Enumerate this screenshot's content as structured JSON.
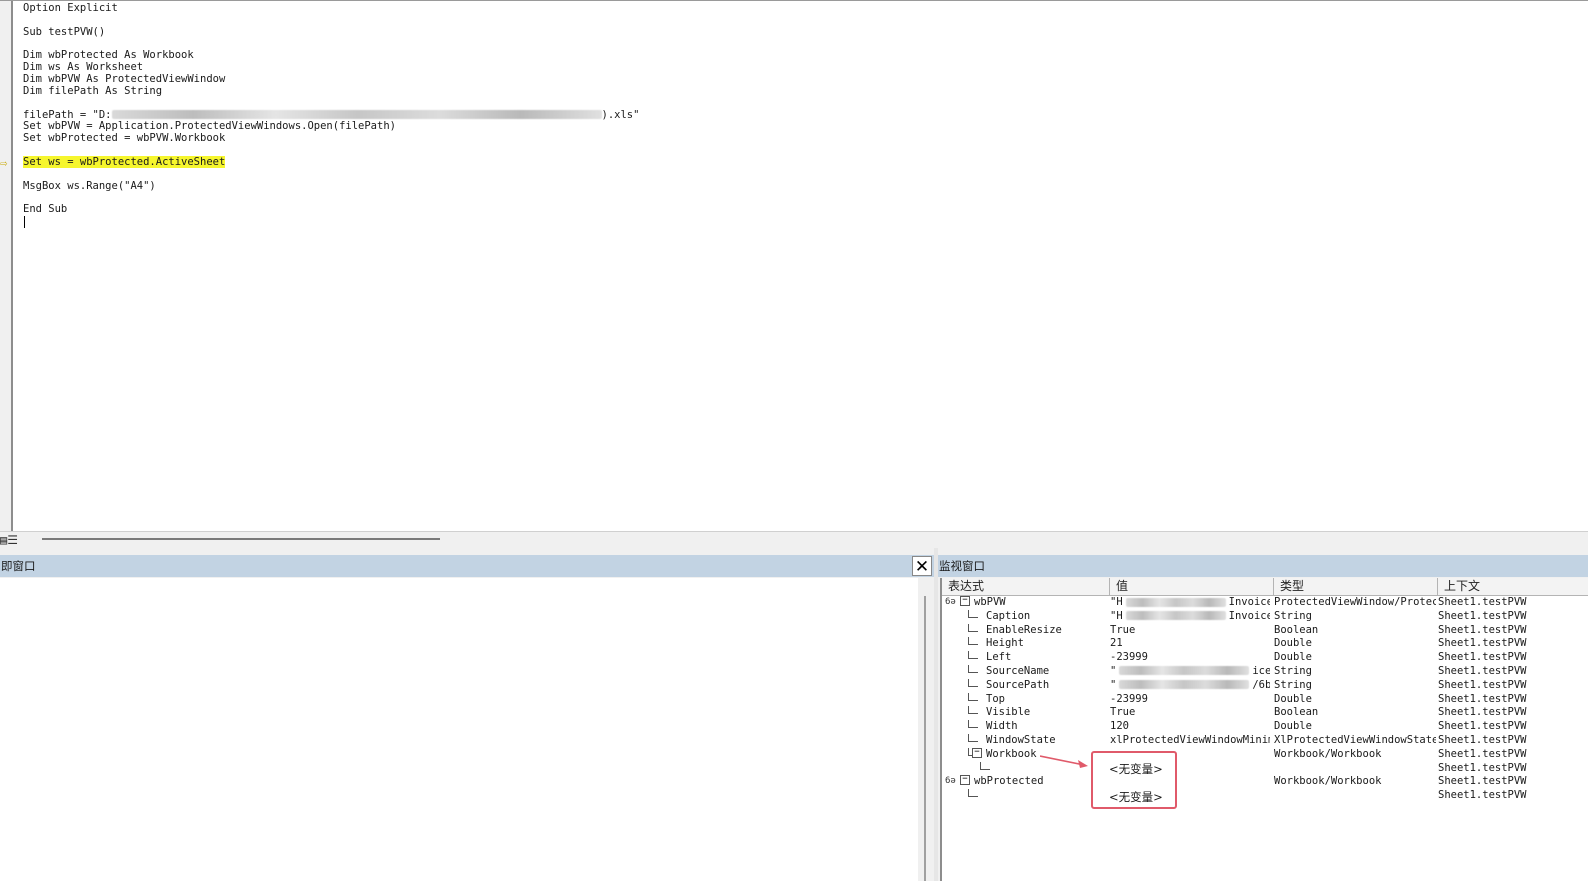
{
  "editor": {
    "lines": [
      {
        "text": "Option Explicit"
      },
      {
        "text": ""
      },
      {
        "text": "Sub testPVW()"
      },
      {
        "text": ""
      },
      {
        "text": "Dim wbProtected As Workbook"
      },
      {
        "text": "Dim ws As Worksheet"
      },
      {
        "text": "Dim wbPVW As ProtectedViewWindow"
      },
      {
        "text": "Dim filePath As String"
      },
      {
        "text": ""
      },
      {
        "text": "filePath = \"D:",
        "redacted_suffix": ").xls\""
      },
      {
        "text": "Set wbPVW = Application.ProtectedViewWindows.Open(filePath)"
      },
      {
        "text": "Set wbProtected = wbPVW.Workbook"
      },
      {
        "text": ""
      },
      {
        "text": "Set ws = wbProtected.ActiveSheet",
        "highlight": true
      },
      {
        "text": ""
      },
      {
        "text": "MsgBox ws.Range(\"A4\")"
      },
      {
        "text": ""
      },
      {
        "text": "End Sub"
      }
    ],
    "exec_arrow": "⇨",
    "view_icons": "▤☰"
  },
  "immediate": {
    "title": "即窗口",
    "close": "✕"
  },
  "watch": {
    "title": "监视窗口",
    "columns": [
      "表达式",
      "值",
      "类型",
      "上下文"
    ],
    "rows": [
      {
        "expr": "wbPVW",
        "value": "\"H",
        "value_tail": "Invoice",
        "type": "ProtectedViewWindow/Protect",
        "context": "Sheet1.testPVW",
        "level": 0,
        "expander": "−",
        "glasses": true
      },
      {
        "expr": "Caption",
        "value": "\"H",
        "value_tail": "Invoice",
        "type": "String",
        "context": "Sheet1.testPVW",
        "level": 1
      },
      {
        "expr": "EnableResize",
        "value": "True",
        "type": "Boolean",
        "context": "Sheet1.testPVW",
        "level": 1
      },
      {
        "expr": "Height",
        "value": "21",
        "type": "Double",
        "context": "Sheet1.testPVW",
        "level": 1
      },
      {
        "expr": "Left",
        "value": "-23999",
        "type": "Double",
        "context": "Sheet1.testPVW",
        "level": 1
      },
      {
        "expr": "SourceName",
        "value": "\"",
        "value_tail": "ice",
        "type": "String",
        "context": "Sheet1.testPVW",
        "level": 1
      },
      {
        "expr": "SourcePath",
        "value": "\"",
        "value_tail": "/6b",
        "type": "String",
        "context": "Sheet1.testPVW",
        "level": 1
      },
      {
        "expr": "Top",
        "value": "-23999",
        "type": "Double",
        "context": "Sheet1.testPVW",
        "level": 1
      },
      {
        "expr": "Visible",
        "value": "True",
        "type": "Boolean",
        "context": "Sheet1.testPVW",
        "level": 1
      },
      {
        "expr": "Width",
        "value": "120",
        "type": "Double",
        "context": "Sheet1.testPVW",
        "level": 1
      },
      {
        "expr": "WindowState",
        "value": "xlProtectedViewWindowMinimi",
        "type": "XlProtectedViewWindowState",
        "context": "Sheet1.testPVW",
        "level": 1
      },
      {
        "expr": "Workbook",
        "value": "",
        "type": "Workbook/Workbook",
        "context": "Sheet1.testPVW",
        "level": 1,
        "expander": "−"
      },
      {
        "expr": "",
        "value": "",
        "type": "",
        "context": "Sheet1.testPVW",
        "level": 2
      },
      {
        "expr": "wbProtected",
        "value": "",
        "type": "Workbook/Workbook",
        "context": "Sheet1.testPVW",
        "level": 0,
        "expander": "−",
        "glasses": true
      },
      {
        "expr": "",
        "value": "",
        "type": "",
        "context": "Sheet1.testPVW",
        "level": 1
      }
    ],
    "annotation": {
      "label_1": "<无变量>",
      "label_2": "<无变量>",
      "color": "#e05a6a"
    }
  }
}
